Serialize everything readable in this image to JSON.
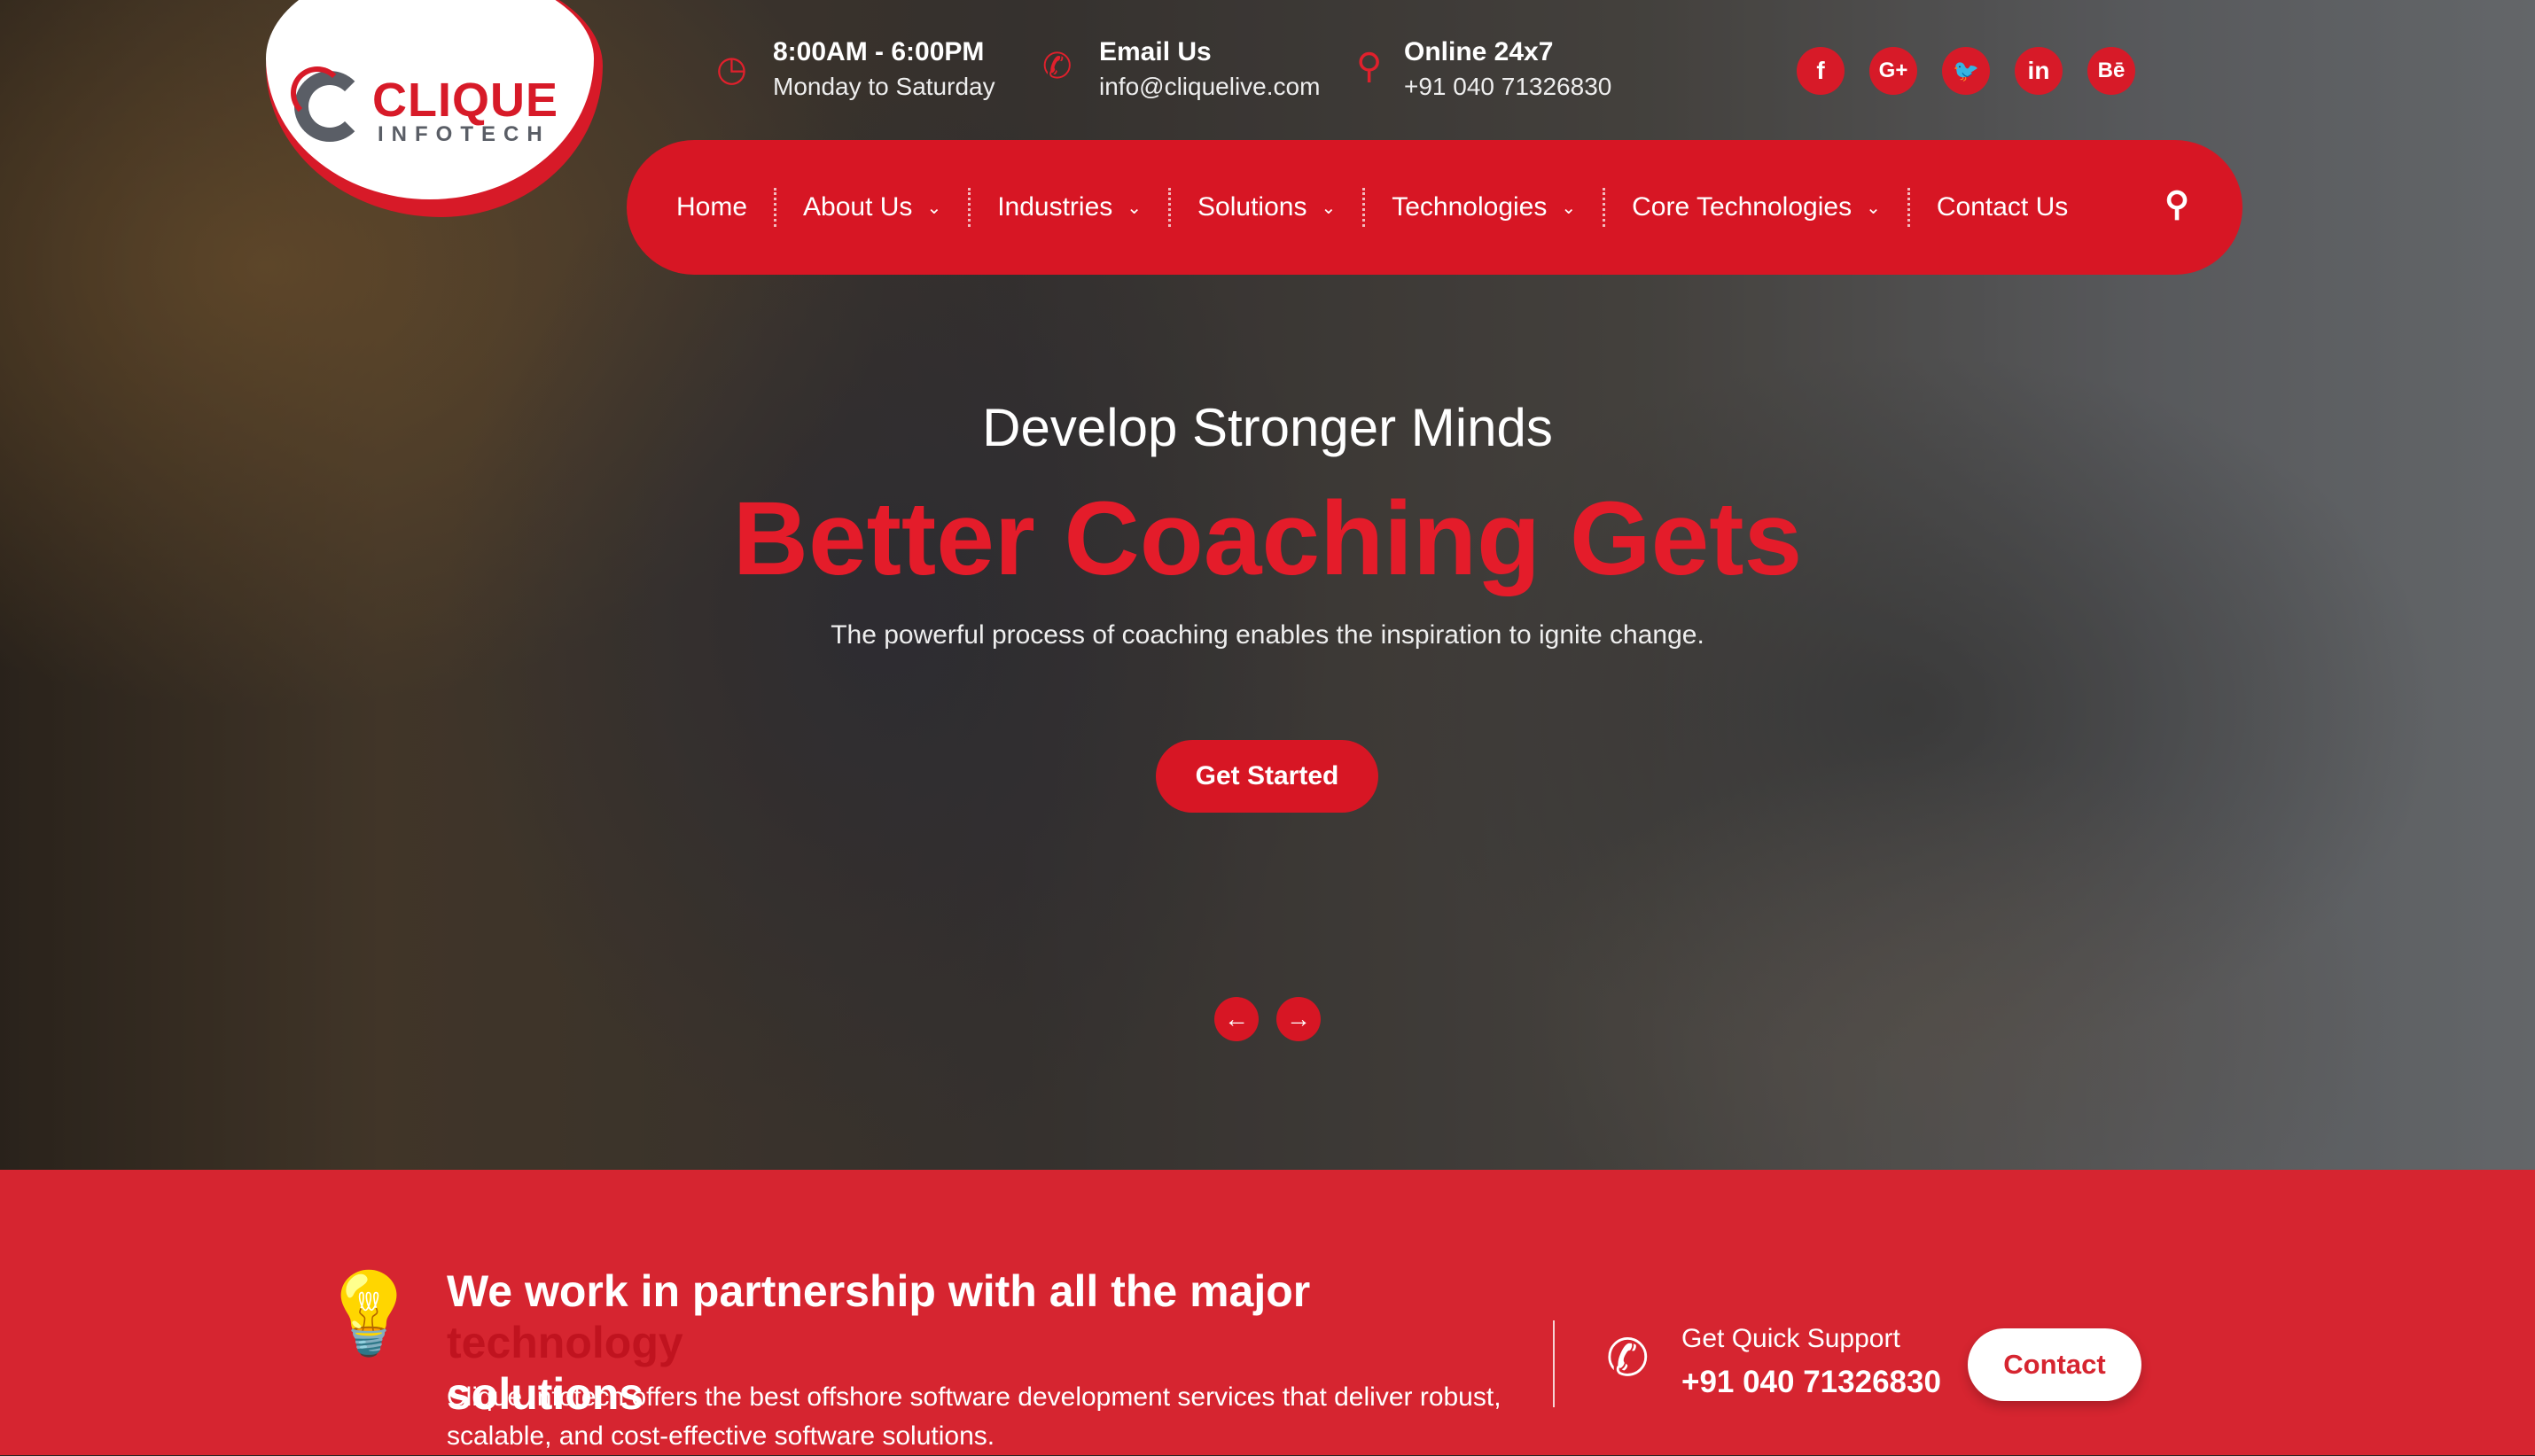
{
  "logo": {
    "brand": "CLIQUE",
    "sub": "INFOTECH"
  },
  "topbar": {
    "hours": {
      "icon": "clock-icon",
      "title": "8:00AM - 6:00PM",
      "sub": "Monday to Saturday"
    },
    "email": {
      "icon": "phone-icon",
      "title": "Email Us",
      "sub": "info@cliquelive.com"
    },
    "online": {
      "icon": "map-pin-icon",
      "title": "Online 24x7",
      "sub": "+91 040 71326830"
    },
    "social": [
      {
        "name": "facebook",
        "glyph": "f"
      },
      {
        "name": "google-plus",
        "glyph": "G+"
      },
      {
        "name": "twitter",
        "glyph": "🐦"
      },
      {
        "name": "linkedin",
        "glyph": "in"
      },
      {
        "name": "behance",
        "glyph": "Bē"
      }
    ]
  },
  "nav": {
    "items": [
      {
        "label": "Home"
      },
      {
        "label": "About Us",
        "dropdown": true
      },
      {
        "label": "Industries",
        "dropdown": true
      },
      {
        "label": "Solutions",
        "dropdown": true
      },
      {
        "label": "Technologies",
        "dropdown": true
      },
      {
        "label": "Core Technologies",
        "dropdown": true
      },
      {
        "label": "Contact Us"
      }
    ],
    "chevron": "⌄",
    "search": "⚲"
  },
  "hero": {
    "title": "Develop Stronger Minds",
    "headline": "Better Coaching Gets",
    "subtitle": "The powerful process of coaching enables the inspiration to ignite change.",
    "cta": "Get Started",
    "prev": "←",
    "next": "→"
  },
  "band": {
    "heading": "We work in partnership with all the major",
    "heading_highlight": "technology",
    "heading_end": "solutions",
    "paragraph": "Clique Infotech offers the best offshore software development services that deliver robust, scalable, and cost-effective software solutions.",
    "support_label": "Get Quick Support",
    "support_phone": "+91 040 71326830",
    "contact_button": "Contact"
  },
  "colors": {
    "brand": "#d71624",
    "band": "#d62530"
  }
}
